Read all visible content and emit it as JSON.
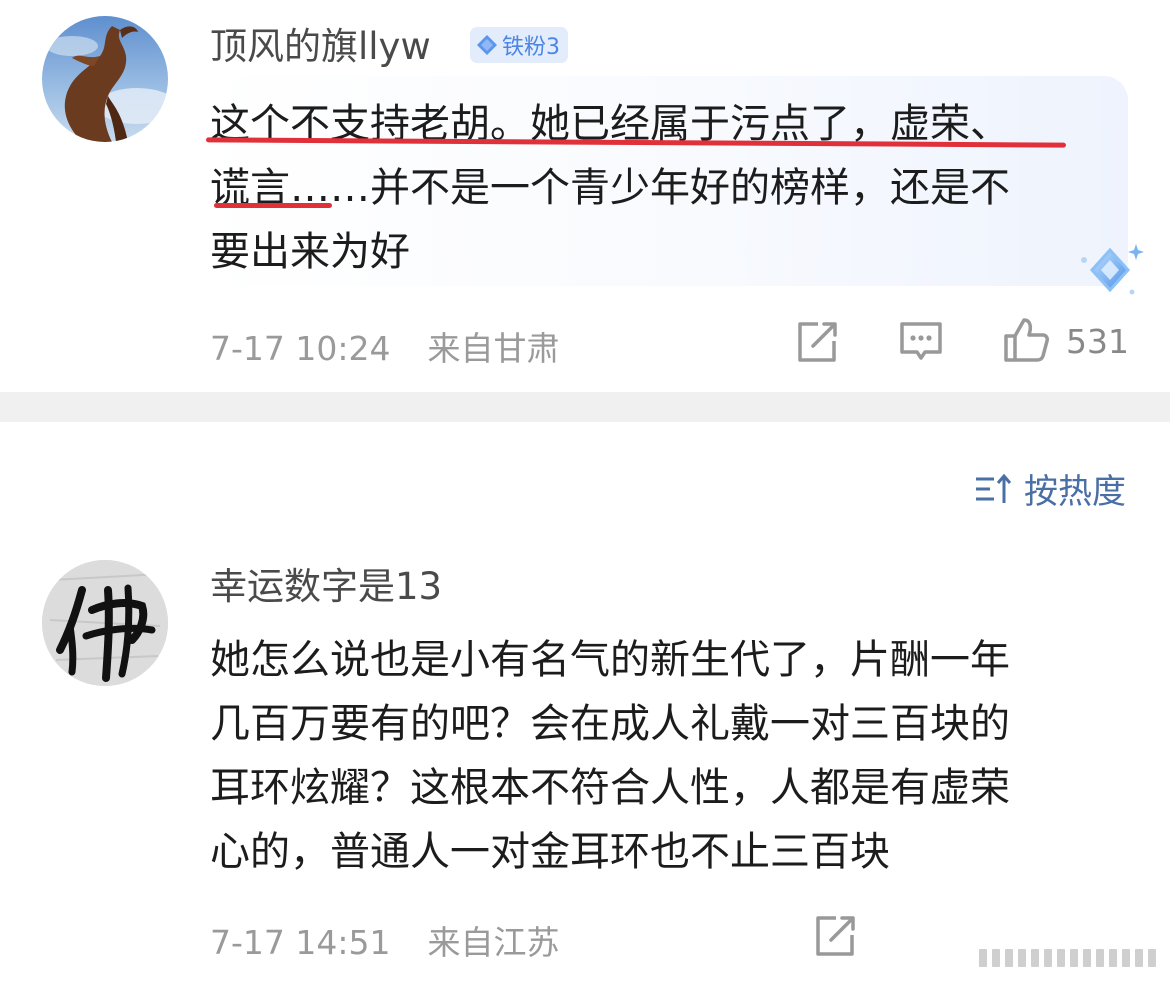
{
  "comments": [
    {
      "username": "顶风的旗llyw",
      "badge": "铁粉3",
      "lines": [
        "这个不支持老胡。她已经属于污点了，虚荣、",
        "谎言……并不是一个青少年好的榜样，还是不",
        "要出来为好"
      ],
      "time": "7-17 10:24",
      "location": "来自甘肃",
      "likes": "531"
    },
    {
      "username": "幸运数字是13",
      "avatar_char": "佛",
      "lines": [
        "她怎么说也是小有名气的新生代了，片酬一年",
        "几百万要有的吧？会在成人礼戴一对三百块的",
        "耳环炫耀？这根本不符合人性，人都是有虚荣",
        "心的，普通人一对金耳环也不止三百块"
      ],
      "time": "7-17 14:51",
      "location": "来自江苏"
    }
  ],
  "sort": {
    "label": "按热度"
  },
  "colors": {
    "underline": "#e0303a",
    "badge_bg": "#e3ecfb",
    "badge_text": "#4b86e6",
    "sort_text": "#4a6fa5"
  },
  "icons": {
    "repost": "share-icon",
    "comment": "comment-icon",
    "like": "thumbs-up-icon",
    "sort": "sort-icon",
    "badge": "diamond-icon",
    "sparkle": "diamond-sparkle-icon"
  }
}
